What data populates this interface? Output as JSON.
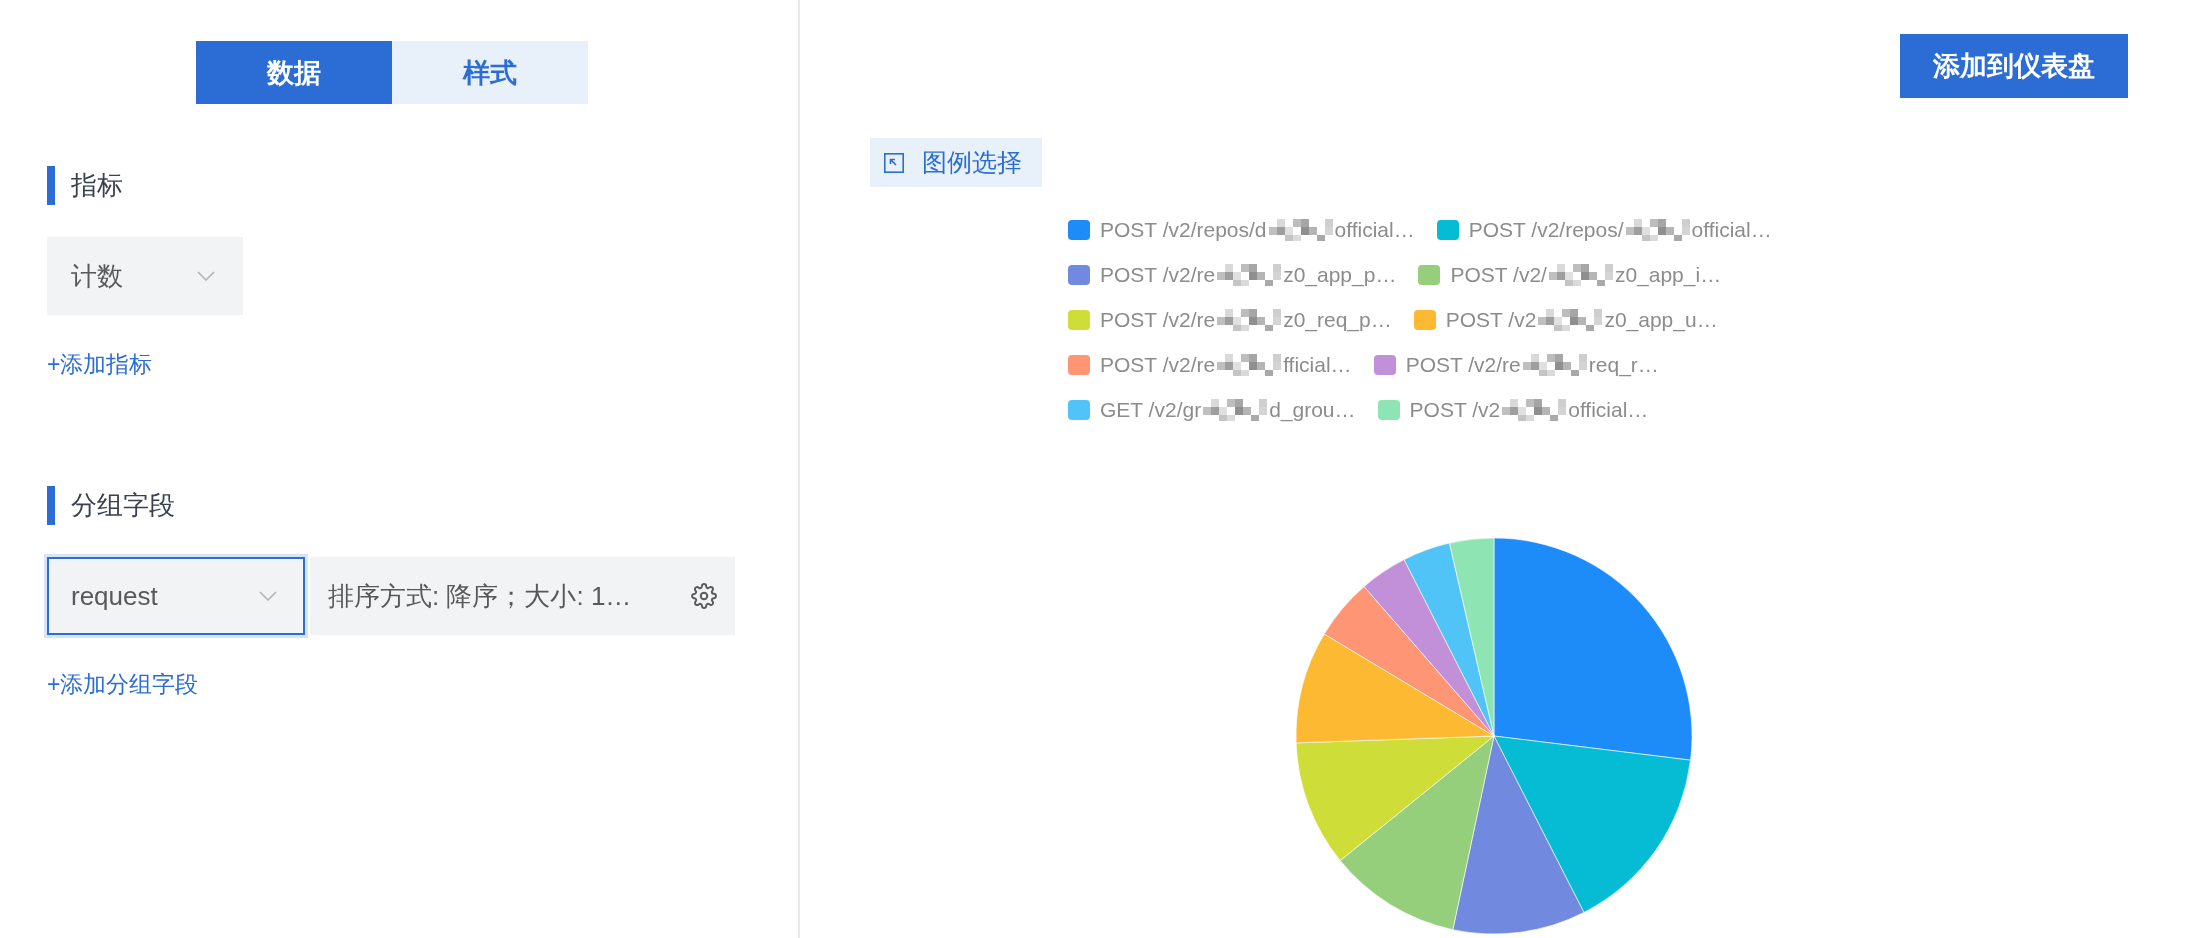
{
  "tabs": [
    {
      "label": "数据",
      "selected": true
    },
    {
      "label": "样式",
      "selected": false
    }
  ],
  "metrics": {
    "title": "指标",
    "select": {
      "value": "计数",
      "focused": false
    },
    "add_link": "+添加指标"
  },
  "group_fields": {
    "title": "分组字段",
    "select": {
      "value": "request",
      "focused": true
    },
    "sort_settings": "排序方式: 降序；大小: 1…",
    "add_link": "+添加分组字段"
  },
  "add_to_dashboard_button": "添加到仪表盘",
  "legend_select_button": "图例选择",
  "legend": {
    "items": [
      {
        "prefix": "POST /v2/repos/d",
        "suffix": "official…",
        "color": "#1d8cf8"
      },
      {
        "prefix": "POST /v2/repos/",
        "suffix": "official…",
        "color": "#05bcd4"
      },
      {
        "prefix": "POST /v2/re",
        "suffix": "z0_app_p…",
        "color": "#7289e0"
      },
      {
        "prefix": "POST /v2/",
        "suffix": "z0_app_i…",
        "color": "#96cf7b"
      },
      {
        "prefix": "POST /v2/re",
        "suffix": "z0_req_p…",
        "color": "#cfdd39"
      },
      {
        "prefix": "POST /v2",
        "suffix": "z0_app_u…",
        "color": "#feb933"
      },
      {
        "prefix": "POST /v2/re",
        "suffix": "fficial…",
        "color": "#fe9574"
      },
      {
        "prefix": "POST /v2/re",
        "suffix": "req_r…",
        "color": "#c290d8"
      },
      {
        "prefix": "GET /v2/gr",
        "suffix": "d_grou…",
        "color": "#50c3f7"
      },
      {
        "prefix": "POST /v2",
        "suffix": "official…",
        "color": "#8fe4b4"
      }
    ]
  }
}
